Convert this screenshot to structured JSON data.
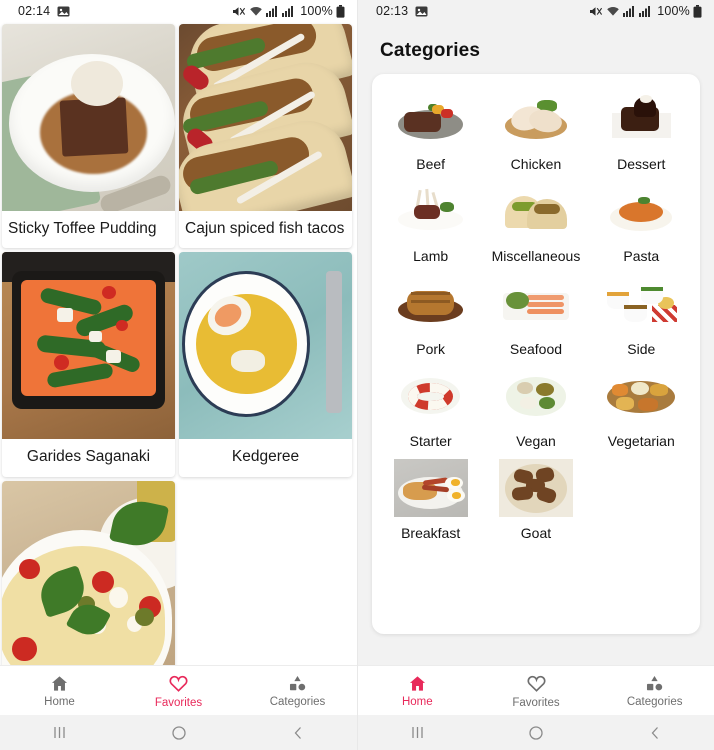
{
  "left_screen": {
    "statusbar": {
      "clock": "02:14",
      "battery_pct": "100%",
      "icons": [
        "image-icon",
        "mute-icon",
        "wifi-icon",
        "signal-icon",
        "signal-icon",
        "battery-icon"
      ]
    },
    "meals": [
      {
        "title": "Sticky Toffee Pudding",
        "align": "left",
        "art": "a-pud"
      },
      {
        "title": "Cajun spiced fish tacos",
        "align": "left",
        "art": "a-taco"
      },
      {
        "title": "Garides Saganaki",
        "align": "center",
        "art": "a-sag"
      },
      {
        "title": "Kedgeree",
        "align": "center",
        "art": "a-ked"
      },
      {
        "title": "",
        "align": "center",
        "art": "a-pasta"
      }
    ],
    "tabs": [
      {
        "label": "Home",
        "icon": "home-icon",
        "active": false
      },
      {
        "label": "Favorites",
        "icon": "heart-icon",
        "active": true
      },
      {
        "label": "Categories",
        "icon": "categories-icon",
        "active": false
      }
    ]
  },
  "right_screen": {
    "statusbar": {
      "clock": "02:13",
      "battery_pct": "100%",
      "icons": [
        "image-icon",
        "mute-icon",
        "wifi-icon",
        "signal-icon",
        "signal-icon",
        "battery-icon"
      ]
    },
    "heading": "Categories",
    "categories": [
      {
        "label": "Beef",
        "art": "cb-beef"
      },
      {
        "label": "Chicken",
        "art": "cb-chick"
      },
      {
        "label": "Dessert",
        "art": "cb-dess"
      },
      {
        "label": "Lamb",
        "art": "cb-lamb"
      },
      {
        "label": "Miscellaneous",
        "art": "cb-misc"
      },
      {
        "label": "Pasta",
        "art": "cb-pasta"
      },
      {
        "label": "Pork",
        "art": "cb-pork"
      },
      {
        "label": "Seafood",
        "art": "cb-sea"
      },
      {
        "label": "Side",
        "art": "cb-side"
      },
      {
        "label": "Starter",
        "art": "cb-start"
      },
      {
        "label": "Vegan",
        "art": "cb-vegan"
      },
      {
        "label": "Vegetarian",
        "art": "cb-vegt"
      },
      {
        "label": "Breakfast",
        "art": "cb-brk"
      },
      {
        "label": "Goat",
        "art": "cb-goat"
      }
    ],
    "tabs": [
      {
        "label": "Home",
        "icon": "home-icon",
        "active": true
      },
      {
        "label": "Favorites",
        "icon": "heart-icon",
        "active": false
      },
      {
        "label": "Categories",
        "icon": "categories-icon",
        "active": false
      }
    ]
  },
  "android_nav": {
    "recents": "|||",
    "home": "○",
    "back": "‹"
  },
  "colors": {
    "accent": "#e8295a",
    "inactive": "#6e6e6e",
    "screen_bg_left": "#ffffff",
    "screen_bg_right": "#f2f2f2",
    "navbar_bg": "#f2f2f2"
  }
}
